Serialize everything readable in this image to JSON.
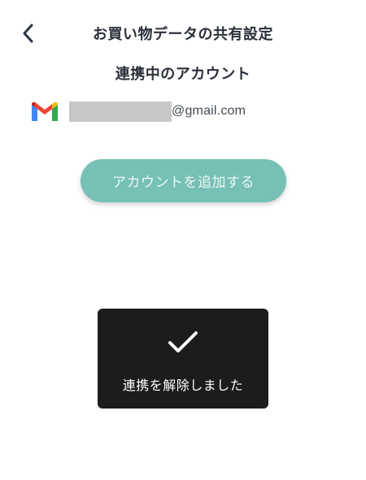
{
  "header": {
    "back_icon": "chevron-left-icon",
    "title": "お買い物データの共有設定"
  },
  "section": {
    "title": "連携中のアカウント"
  },
  "account": {
    "icon": "gmail-icon",
    "email_domain": "@gmail.com"
  },
  "actions": {
    "add_account_label": "アカウントを追加する"
  },
  "toast": {
    "icon": "checkmark-icon",
    "message": "連携を解除しました"
  },
  "colors": {
    "accent": "#76c0b6",
    "text": "#2b2f3a",
    "toast_bg": "#1c1c1c",
    "redaction": "#c7c7c7"
  }
}
